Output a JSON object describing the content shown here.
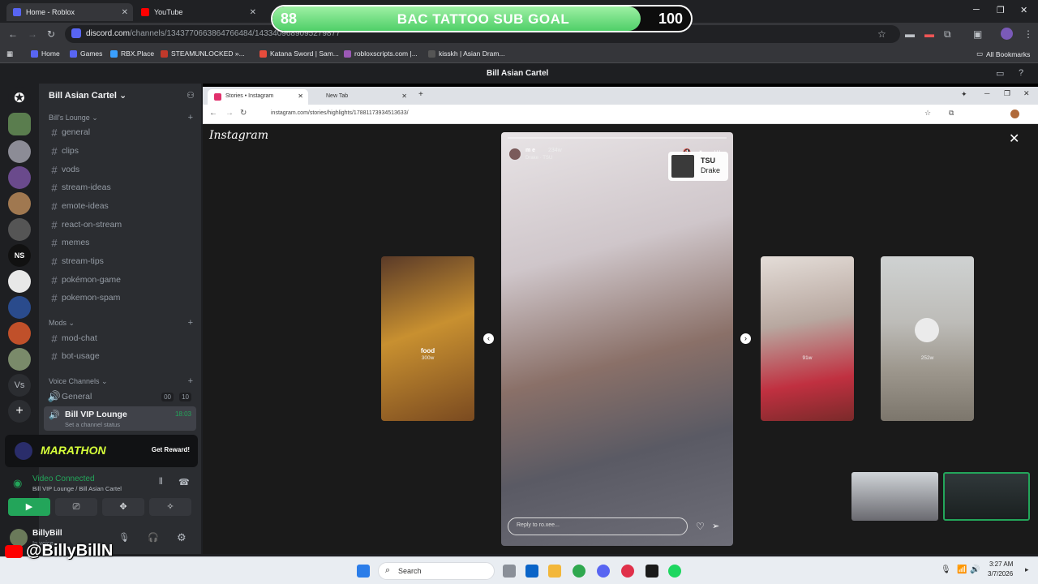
{
  "chrome": {
    "tabs": [
      {
        "title": "Home - Roblox"
      },
      {
        "title": "YouTube"
      }
    ],
    "url_host": "discord.com",
    "url_rest": "/channels/1343770663864766484/1433409689095279877",
    "bookmarks": [
      "Home",
      "Games",
      "RBX.Place",
      "STEAMUNLOCKED »...",
      "Katana Sword | Sam...",
      "robloxscripts.com |...",
      "kisskh | Asian Dram..."
    ],
    "all_bookmarks": "All Bookmarks"
  },
  "subgoal": {
    "current": "88",
    "title": "BAC TATTOO SUB GOAL",
    "target": "100",
    "progress": 0.88
  },
  "discord": {
    "window_title": "Bill Asian Cartel",
    "server_name": "Bill Asian Cartel",
    "categories": [
      {
        "label": "Bill's Lounge",
        "channels": [
          "general",
          "clips",
          "vods",
          "stream-ideas",
          "emote-ideas",
          "react-on-stream",
          "memes",
          "stream-tips",
          "pokémon-game",
          "pokemon-spam"
        ]
      },
      {
        "label": "Mods",
        "channels": [
          "mod-chat",
          "bot-usage"
        ]
      },
      {
        "label": "Voice Channels",
        "channels": [
          "General",
          "Bill VIP Lounge"
        ]
      }
    ],
    "voice_general_counts": [
      "00",
      "10"
    ],
    "vip_time": "18:03",
    "vip_status": "Set a channel status",
    "promo": {
      "logo": "MARATHON",
      "cta": "Get Reward!"
    },
    "video": {
      "status": "Video Connected",
      "location": "Bill VIP Lounge / Bill Asian Cartel"
    },
    "user": {
      "name": "BillyBill",
      "status": "In voice"
    }
  },
  "stream": {
    "ig_tabs": [
      "Stories • Instagram",
      "New Tab"
    ],
    "ig_url": "instagram.com/stories/highlights/17881173934513633/",
    "ig_logo": "Instagram",
    "story_user": "m e",
    "story_time": "234w",
    "story_song": "Drake · TSU",
    "song_title": "TSU",
    "song_artist": "Drake",
    "reply_placeholder": "Reply to ro.xee...",
    "highlights": [
      {
        "label": "food",
        "time": "300w"
      },
      {
        "label": "",
        "time": "91w"
      },
      {
        "label": "",
        "time": "252w"
      }
    ]
  },
  "taskbar": {
    "search": "Search",
    "time": "3:27 AM",
    "date": "3/7/2026"
  },
  "watermark": "@BillyBillN"
}
